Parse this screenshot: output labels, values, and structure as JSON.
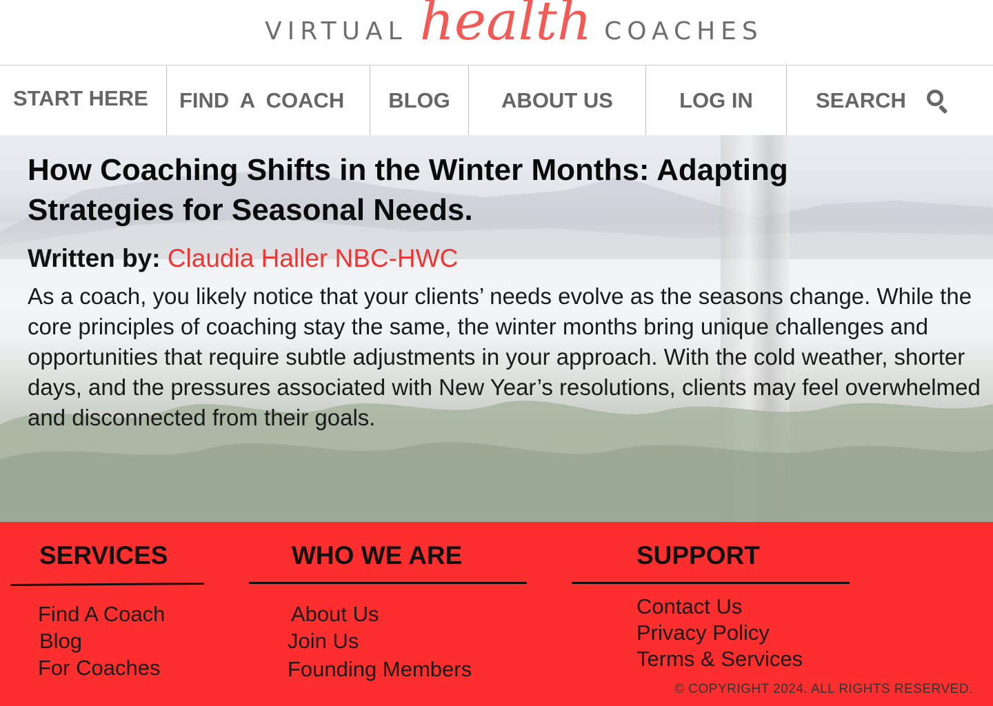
{
  "brand": {
    "left": "VIRTUAL",
    "middle": "health",
    "right": "COACHES"
  },
  "nav": {
    "start": "START HERE",
    "find": "FIND  A COACH",
    "blog": "BLOG",
    "about": "ABOUT US",
    "login": "LOG IN",
    "search": "SEARCH"
  },
  "article": {
    "title": "How Coaching Shifts in the Winter Months: Adapting Strategies for Seasonal Needs.",
    "byline_label": "Written by: ",
    "author": "Claudia Haller NBC-HWC",
    "intro": "As a coach, you likely notice that your clients’ needs evolve as the seasons change. While the core principles of coaching stay the same, the winter months bring unique challenges and opportunities that require subtle adjustments in your approach. With the cold weather, shorter days, and the pressures associated with New Year’s resolutions, clients may feel overwhelmed and disconnected from their goals."
  },
  "footer": {
    "services": {
      "heading": "SERVICES",
      "links": [
        "Find A Coach",
        "Blog",
        "For Coaches"
      ]
    },
    "who": {
      "heading": "WHO WE ARE",
      "links": [
        "About Us",
        "Join Us",
        "Founding Members"
      ]
    },
    "support": {
      "heading": "SUPPORT",
      "links": [
        "Contact Us",
        "Privacy Policy",
        "Terms & Services"
      ]
    },
    "copyright": "© COPYRIGHT 2024. ALL RIGHTS RESERVED."
  },
  "colors": {
    "accent": "#ee3532",
    "footer_bg": "#fd2e2e",
    "nav_text": "#666666"
  }
}
